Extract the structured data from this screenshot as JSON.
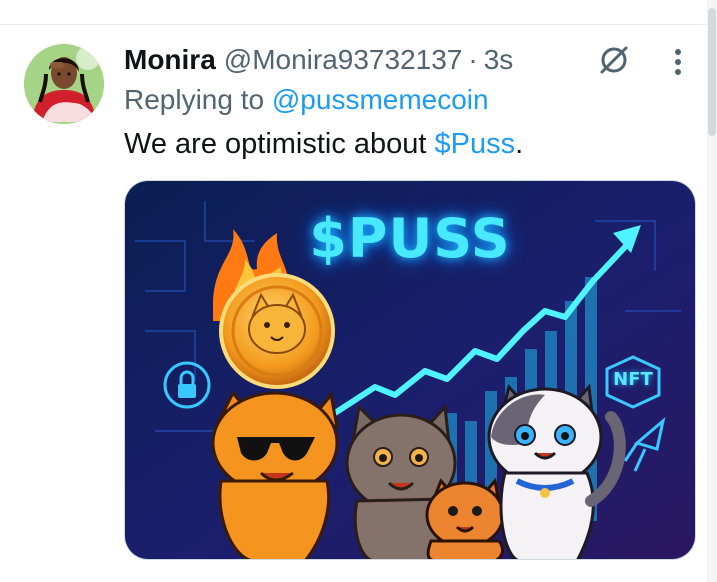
{
  "tweet": {
    "author_name": "Monira",
    "author_handle": "@Monira93732137",
    "separator": "·",
    "timestamp": "3s",
    "reply_prefix": "Replying to",
    "reply_to": "@pussmemecoin",
    "text_before": "We are optimistic about ",
    "cashtag": "$Puss",
    "text_after": "."
  },
  "media": {
    "title": "$PUSS",
    "nft_label": "NFT"
  },
  "icons": {
    "grok": "slashed-circle-icon",
    "more": "more-vertical-icon"
  },
  "colors": {
    "link": "#1d9bf0",
    "secondary_text": "#536471",
    "primary_text": "#0f1419",
    "media_glow": "#48e8ff"
  }
}
